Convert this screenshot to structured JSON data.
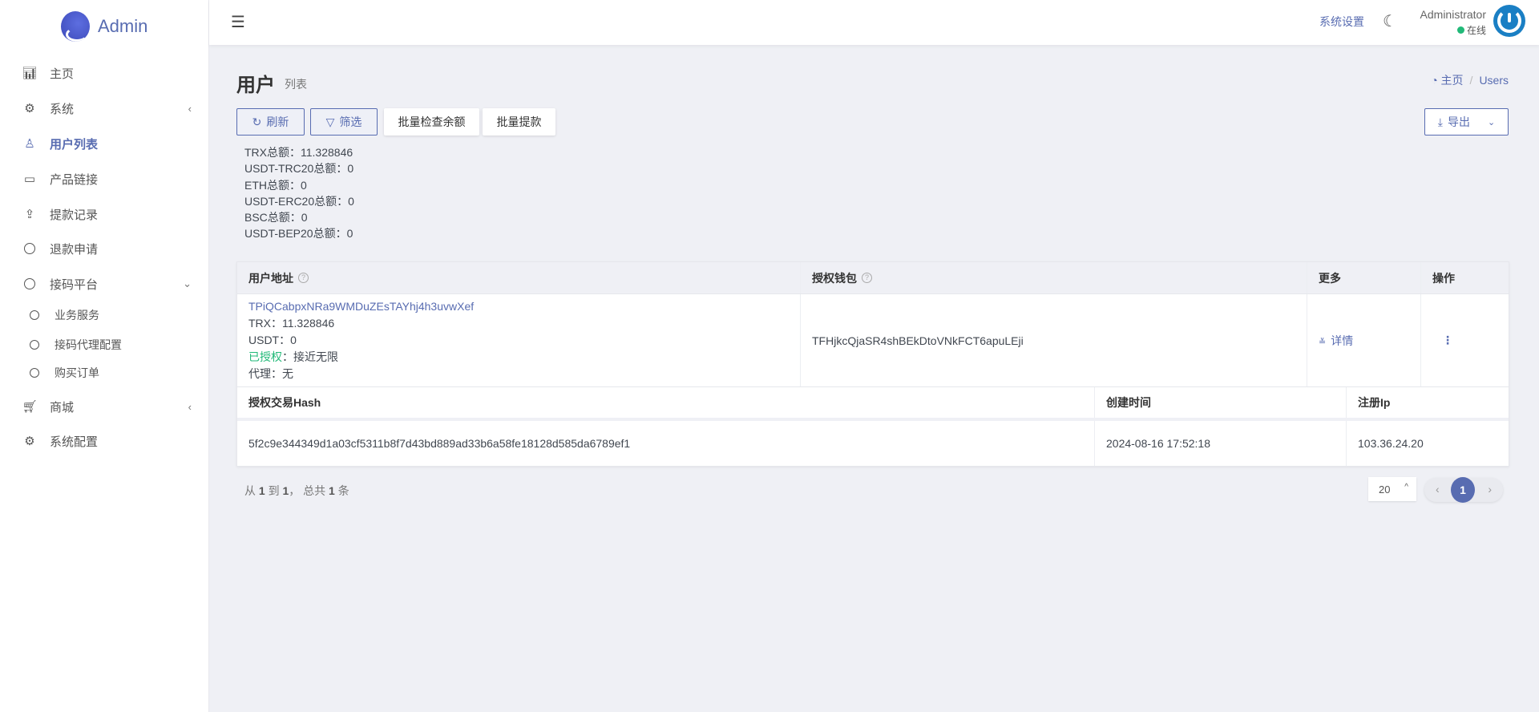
{
  "brand": {
    "name": "Admin"
  },
  "sidebar": {
    "items": [
      {
        "label": "主页",
        "icon": "bar-chart-icon"
      },
      {
        "label": "系统",
        "icon": "gear-icon"
      },
      {
        "label": "用户列表",
        "icon": "user-icon"
      },
      {
        "label": "产品链接",
        "icon": "airplay-icon"
      },
      {
        "label": "提款记录",
        "icon": "upload-icon"
      },
      {
        "label": "退款申请",
        "icon": "circle-icon"
      },
      {
        "label": "接码平台",
        "icon": "circle-icon"
      },
      {
        "label": "业务服务",
        "icon": "circle-icon"
      },
      {
        "label": "接码代理配置",
        "icon": "circle-icon"
      },
      {
        "label": "购买订单",
        "icon": "circle-icon"
      },
      {
        "label": "商城",
        "icon": "cart-icon"
      },
      {
        "label": "系统配置",
        "icon": "gears-icon"
      }
    ]
  },
  "header": {
    "settings": "系统设置",
    "user_name": "Administrator",
    "status": "在线"
  },
  "page": {
    "title": "用户",
    "subtitle": "列表",
    "breadcrumb_home": "主页",
    "breadcrumb_current": "Users"
  },
  "toolbar": {
    "refresh": "刷新",
    "filter": "筛选",
    "batch_check": "批量检查余额",
    "batch_withdraw": "批量提款",
    "export": "导出"
  },
  "totals": [
    "TRX总额：11.328846",
    "USDT-TRC20总额：0",
    "ETH总额：0",
    "USDT-ERC20总额：0",
    "BSC总额：0",
    "USDT-BEP20总额：0"
  ],
  "table": {
    "headers": [
      "用户地址",
      "授权钱包",
      "更多",
      "操作"
    ],
    "row": {
      "address": "TPiQCabpxNRa9WMDuZEsTAYhj4h3uvwXef",
      "trx": "TRX：11.328846",
      "usdt": "USDT：0",
      "auth_label": "已授权",
      "auth_value": "：接近无限",
      "agent": "代理：无",
      "wallet": "TFHjkcQjaSR4shBEkDtoVNkFCT6apuLEji",
      "detail": "详情"
    },
    "sub_headers": [
      "授权交易Hash",
      "创建时间",
      "注册Ip"
    ],
    "sub_row": {
      "hash": "5f2c9e344349d1a03cf5311b8f7d43bd889ad33b6a58fe18128d585da6789ef1",
      "created": "2024-08-16 17:52:18",
      "ip": "103.36.24.20"
    }
  },
  "pagination": {
    "from": "从",
    "start": "1",
    "to": "到",
    "end": "1",
    "total_prefix": "， 总共",
    "total": "1",
    "unit": "条",
    "page_size": "20",
    "current_page": "1"
  },
  "colors": {
    "accent": "#586cb1",
    "success": "#21b978"
  }
}
